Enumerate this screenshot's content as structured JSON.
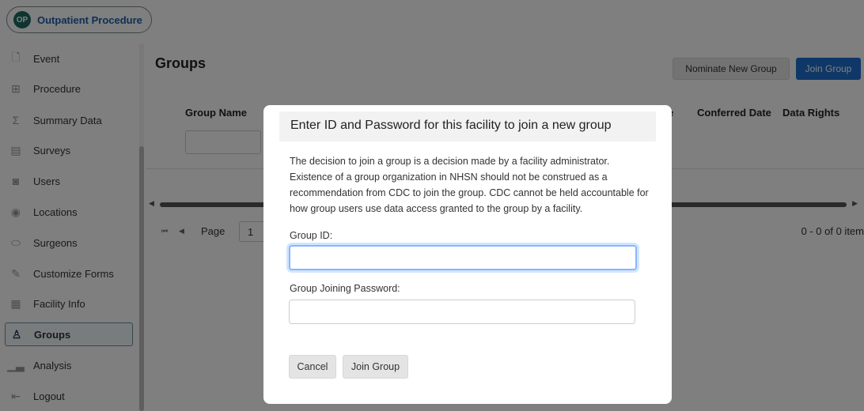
{
  "app": {
    "title": "Outpatient Procedure",
    "logo_text": "OP"
  },
  "sidebar": {
    "items": [
      {
        "label": "Event",
        "icon": "document-icon",
        "glyph": "🗋",
        "active": false
      },
      {
        "label": "Procedure",
        "icon": "procedure-table-icon",
        "glyph": "⊞",
        "active": false
      },
      {
        "label": "Summary Data",
        "icon": "sigma-icon",
        "glyph": "Σ",
        "active": false
      },
      {
        "label": "Surveys",
        "icon": "clipboard-icon",
        "glyph": "▤",
        "active": false
      },
      {
        "label": "Users",
        "icon": "user-badge-icon",
        "glyph": "◙",
        "active": false
      },
      {
        "label": "Locations",
        "icon": "location-pin-icon",
        "glyph": "◉",
        "active": false
      },
      {
        "label": "Surgeons",
        "icon": "surgeon-mask-icon",
        "glyph": "⬭",
        "active": false
      },
      {
        "label": "Customize Forms",
        "icon": "edit-form-icon",
        "glyph": "✎",
        "active": false
      },
      {
        "label": "Facility Info",
        "icon": "building-icon",
        "glyph": "▦",
        "active": false
      },
      {
        "label": "Groups",
        "icon": "org-chart-icon",
        "glyph": "♙",
        "active": true
      },
      {
        "label": "Analysis",
        "icon": "bar-chart-icon",
        "glyph": "▁▃",
        "active": false
      },
      {
        "label": "Logout",
        "icon": "logout-icon",
        "glyph": "⇤",
        "active": false
      }
    ]
  },
  "main": {
    "title": "Groups",
    "nominate_label": "Nominate New Group",
    "join_label": "Join Group",
    "columns": [
      "Group Name",
      "e",
      "Conferred Date",
      "Data Rights"
    ],
    "page_label": "Page",
    "page_value": "1",
    "item_count": "0 - 0 of 0 item"
  },
  "modal": {
    "title": "Enter ID and Password for this facility to join a new group",
    "description": "The decision to join a group is a decision made by a facility administrator. Existence of a group organization in NHSN should not be construed as a recommendation from CDC to join the group. CDC cannot be held accountable for how group users use data access granted to the group by a facility.",
    "group_id_label": "Group ID:",
    "group_id_value": "",
    "password_label": "Group Joining Password:",
    "password_value": "",
    "cancel_label": "Cancel",
    "join_label": "Join Group"
  },
  "colors": {
    "accent": "#1f6fcf",
    "brand_title": "#1f5fa7",
    "logo_bg": "#1c6b63"
  }
}
